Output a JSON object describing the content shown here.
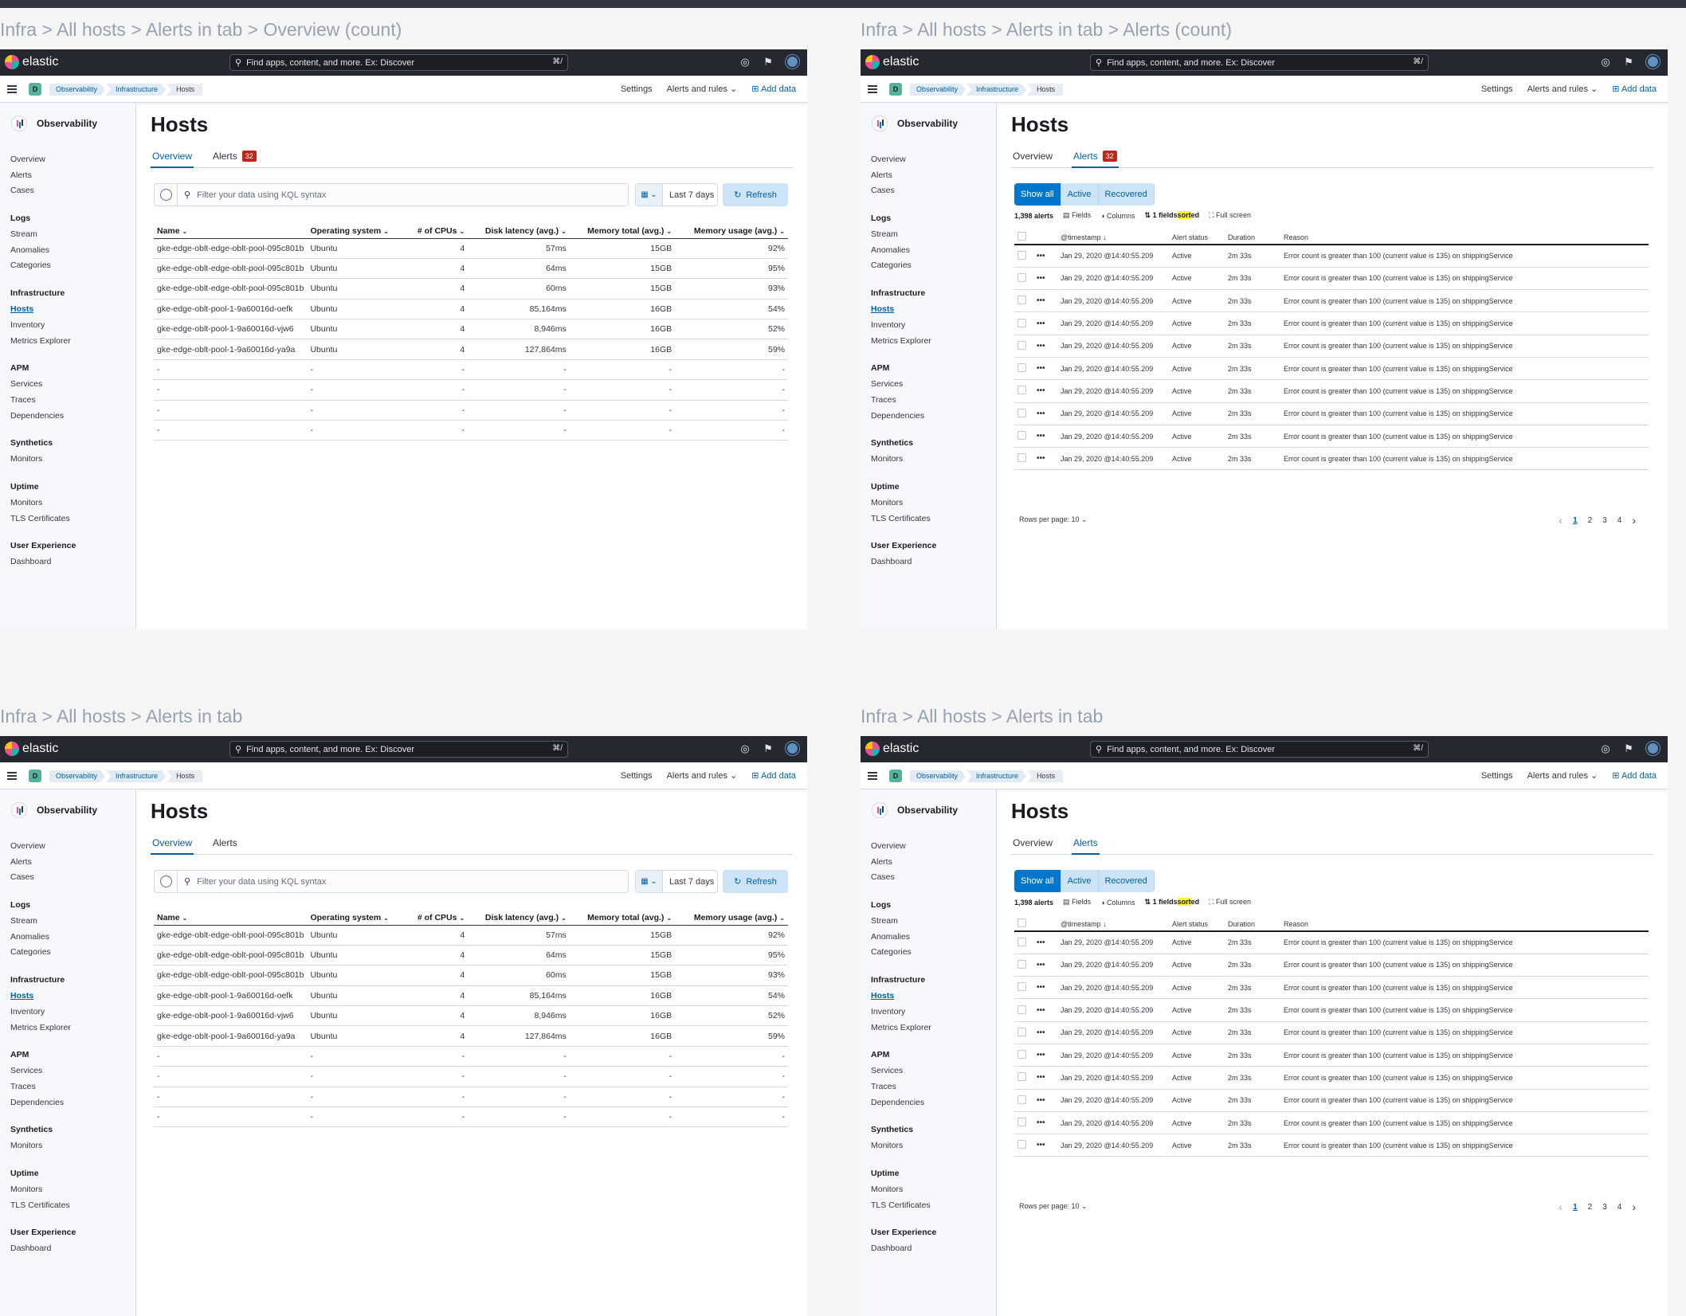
{
  "panels": [
    {
      "caption": "Infra > All hosts > Alerts in tab > Overview (count)",
      "active_tab": "overview",
      "alerts_badge": "32"
    },
    {
      "caption": "Infra > All hosts > Alerts in tab > Alerts (count)",
      "active_tab": "alerts",
      "alerts_badge": "32"
    },
    {
      "caption": "Infra > All hosts > Alerts in tab",
      "active_tab": "overview",
      "alerts_badge": ""
    },
    {
      "caption": "Infra > All hosts > Alerts in tab",
      "active_tab": "alerts",
      "alerts_badge": ""
    }
  ],
  "header": {
    "brand": "elastic",
    "search_placeholder": "Find apps, content, and more. Ex: Discover",
    "search_shortcut": "⌘/",
    "icons": [
      "help-icon",
      "newsfeed-icon",
      "user-avatar"
    ]
  },
  "subheader": {
    "space_letter": "D",
    "breadcrumbs": [
      "Observability",
      "Infrastructure",
      "Hosts"
    ],
    "settings": "Settings",
    "alerts_rules": "Alerts and rules",
    "add_data": "Add data"
  },
  "sidebar": {
    "title": "Observability",
    "groups": [
      {
        "label": "",
        "items": [
          "Overview",
          "Alerts",
          "Cases"
        ]
      },
      {
        "label": "Logs",
        "items": [
          "Stream",
          "Anomalies",
          "Categories"
        ]
      },
      {
        "label": "Infrastructure",
        "items": [
          "Hosts",
          "Inventory",
          "Metrics Explorer"
        ]
      },
      {
        "label": "APM",
        "items": [
          "Services",
          "Traces",
          "Dependencies"
        ]
      },
      {
        "label": "Synthetics",
        "items": [
          "Monitors"
        ]
      },
      {
        "label": "Uptime",
        "items": [
          "Monitors",
          "TLS Certificates"
        ]
      },
      {
        "label": "User Experience",
        "items": [
          "Dashboard"
        ]
      }
    ],
    "active_item": "Hosts"
  },
  "main": {
    "title": "Hosts",
    "tab_overview": "Overview",
    "tab_alerts": "Alerts"
  },
  "overview": {
    "query_placeholder": "Filter your data using KQL syntax",
    "date_range": "Last 7 days",
    "refresh": "Refresh",
    "columns": [
      "Name",
      "Operating system",
      "# of CPUs",
      "Disk latency (avg.)",
      "Memory total (avg.)",
      "Memory usage (avg.)"
    ],
    "rows": [
      [
        "gke-edge-oblt-edge-oblt-pool-095c801b",
        "Ubuntu",
        "4",
        "57ms",
        "15GB",
        "92%"
      ],
      [
        "gke-edge-oblt-edge-oblt-pool-095c801b",
        "Ubuntu",
        "4",
        "64ms",
        "15GB",
        "95%"
      ],
      [
        "gke-edge-oblt-edge-oblt-pool-095c801b",
        "Ubuntu",
        "4",
        "60ms",
        "15GB",
        "93%"
      ],
      [
        "gke-edge-oblt-pool-1-9a60016d-oefk",
        "Ubuntu",
        "4",
        "85,164ms",
        "16GB",
        "54%"
      ],
      [
        "gke-edge-oblt-pool-1-9a60016d-vjw6",
        "Ubuntu",
        "4",
        "8,946ms",
        "16GB",
        "52%"
      ],
      [
        "gke-edge-oblt-pool-1-9a60016d-ya9a",
        "Ubuntu",
        "4",
        "127,864ms",
        "16GB",
        "59%"
      ],
      [
        "-",
        "-",
        "-",
        "-",
        "-",
        "-"
      ],
      [
        "-",
        "-",
        "-",
        "-",
        "-",
        "-"
      ],
      [
        "-",
        "-",
        "-",
        "-",
        "-",
        "-"
      ],
      [
        "-",
        "-",
        "-",
        "-",
        "-",
        "-"
      ]
    ]
  },
  "alerts": {
    "filters": [
      "Show all",
      "Active",
      "Recovered"
    ],
    "count": "1,398 alerts",
    "fields": "Fields",
    "columns_btn": "Columns",
    "sort_prefix": "1 fields",
    "sort_highlight": "sort",
    "sort_suffix": "ed",
    "full_screen": "Full screen",
    "columns": [
      "@timestamp",
      "Alert status",
      "Duration",
      "Reason"
    ],
    "rows": [
      [
        "Jan 29, 2020 @14:40:55.209",
        "Active",
        "2m 33s",
        "Error count is greater than 100 (current value is 135) on shippingService"
      ],
      [
        "Jan 29, 2020 @14:40:55.209",
        "Active",
        "2m 33s",
        "Error count is greater than 100 (current value is 135) on shippingService"
      ],
      [
        "Jan 29, 2020 @14:40:55.209",
        "Active",
        "2m 33s",
        "Error count is greater than 100 (current value is 135) on shippingService"
      ],
      [
        "Jan 29, 2020 @14:40:55.209",
        "Active",
        "2m 33s",
        "Error count is greater than 100 (current value is 135) on shippingService"
      ],
      [
        "Jan 29, 2020 @14:40:55.209",
        "Active",
        "2m 33s",
        "Error count is greater than 100 (current value is 135) on shippingService"
      ],
      [
        "Jan 29, 2020 @14:40:55.209",
        "Active",
        "2m 33s",
        "Error count is greater than 100 (current value is 135) on shippingService"
      ],
      [
        "Jan 29, 2020 @14:40:55.209",
        "Active",
        "2m 33s",
        "Error count is greater than 100 (current value is 135) on shippingService"
      ],
      [
        "Jan 29, 2020 @14:40:55.209",
        "Active",
        "2m 33s",
        "Error count is greater than 100 (current value is 135) on shippingService"
      ],
      [
        "Jan 29, 2020 @14:40:55.209",
        "Active",
        "2m 33s",
        "Error count is greater than 100 (current value is 135) on shippingService"
      ],
      [
        "Jan 29, 2020 @14:40:55.209",
        "Active",
        "2m 33s",
        "Error count is greater than 100 (current value is 135) on shippingService"
      ]
    ],
    "rows_per_page": "Rows per page: 10",
    "pages": [
      "1",
      "2",
      "3",
      "4"
    ],
    "current_page": "1"
  },
  "colors": {
    "header_bg": "#25282f",
    "link": "#0061a6",
    "badge": "#bd271e",
    "primary_button": "#0077cc"
  }
}
